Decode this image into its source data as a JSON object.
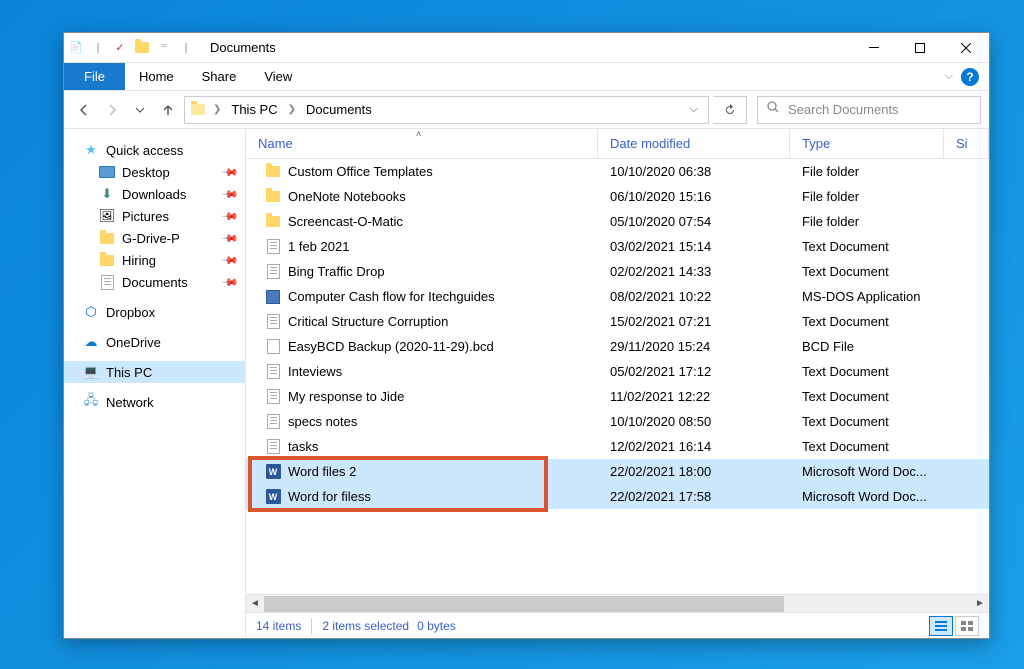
{
  "titlebar": {
    "title": "Documents"
  },
  "menubar": {
    "file": "File",
    "home": "Home",
    "share": "Share",
    "view": "View"
  },
  "breadcrumb": {
    "seg1": "This PC",
    "seg2": "Documents"
  },
  "search": {
    "placeholder": "Search Documents"
  },
  "sidebar": {
    "quick_access": "Quick access",
    "desktop": "Desktop",
    "downloads": "Downloads",
    "pictures": "Pictures",
    "gdrive": "G-Drive-P",
    "hiring": "Hiring",
    "documents": "Documents",
    "dropbox": "Dropbox",
    "onedrive": "OneDrive",
    "this_pc": "This PC",
    "network": "Network"
  },
  "columns": {
    "name": "Name",
    "date": "Date modified",
    "type": "Type",
    "size": "Si"
  },
  "files": [
    {
      "name": "Custom Office Templates",
      "date": "10/10/2020 06:38",
      "type": "File folder",
      "icon": "folder",
      "selected": false
    },
    {
      "name": "OneNote Notebooks",
      "date": "06/10/2020 15:16",
      "type": "File folder",
      "icon": "folder",
      "selected": false
    },
    {
      "name": "Screencast-O-Matic",
      "date": "05/10/2020 07:54",
      "type": "File folder",
      "icon": "folder",
      "selected": false
    },
    {
      "name": "1 feb 2021",
      "date": "03/02/2021 15:14",
      "type": "Text Document",
      "icon": "txt",
      "selected": false
    },
    {
      "name": "Bing Traffic Drop",
      "date": "02/02/2021 14:33",
      "type": "Text Document",
      "icon": "txt",
      "selected": false
    },
    {
      "name": "Computer Cash flow for Itechguides",
      "date": "08/02/2021 10:22",
      "type": "MS-DOS Application",
      "icon": "app",
      "selected": false
    },
    {
      "name": "Critical Structure Corruption",
      "date": "15/02/2021 07:21",
      "type": "Text Document",
      "icon": "txt",
      "selected": false
    },
    {
      "name": "EasyBCD Backup (2020-11-29).bcd",
      "date": "29/11/2020 15:24",
      "type": "BCD File",
      "icon": "bcd",
      "selected": false
    },
    {
      "name": "Inteviews",
      "date": "05/02/2021 17:12",
      "type": "Text Document",
      "icon": "txt",
      "selected": false
    },
    {
      "name": "My response to Jide",
      "date": "11/02/2021 12:22",
      "type": "Text Document",
      "icon": "txt",
      "selected": false
    },
    {
      "name": "specs notes",
      "date": "10/10/2020 08:50",
      "type": "Text Document",
      "icon": "txt",
      "selected": false
    },
    {
      "name": "tasks",
      "date": "12/02/2021 16:14",
      "type": "Text Document",
      "icon": "txt",
      "selected": false
    },
    {
      "name": "Word files 2",
      "date": "22/02/2021 18:00",
      "type": "Microsoft Word Doc...",
      "icon": "word",
      "selected": true
    },
    {
      "name": "Word for filess",
      "date": "22/02/2021 17:58",
      "type": "Microsoft Word Doc...",
      "icon": "word",
      "selected": true
    }
  ],
  "status": {
    "items": "14 items",
    "selected": "2 items selected",
    "bytes": "0 bytes"
  }
}
